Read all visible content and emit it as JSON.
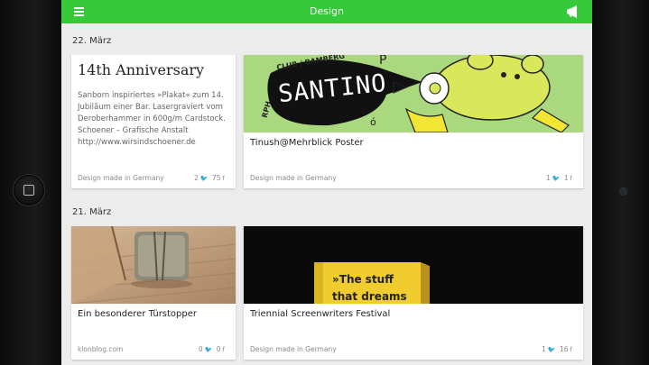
{
  "header": {
    "title": "Design"
  },
  "sections": [
    {
      "date": "22. März"
    },
    {
      "date": "21. März"
    }
  ],
  "cards": [
    {
      "title": "14th Anniversary",
      "text": "Sanborn inspiriertes »Plakat« zum 14. Jubiläum einer Bar. Lasergraviert vom Deroberhammer in 600g/m Cardstock. Schoener – Grafische Anstalt http://www.wirsindschoener.de",
      "source": "Design made in Germany",
      "tweets": "2",
      "likes": "75"
    },
    {
      "title": "Tinush@Mehrblick Poster",
      "image_text": "SANTINO",
      "image_text_2": "CLUB / BAMBERG",
      "image_text_3": "RPH",
      "source": "Design made in Germany",
      "tweets": "1",
      "likes": "1"
    },
    {
      "title": "Ein besonderer Türstopper",
      "source": "klonblog.com",
      "tweets": "0",
      "likes": "0"
    },
    {
      "title": "Triennial Screenwriters Festival",
      "image_text": "»The stuff",
      "image_text_2": "that dreams",
      "source": "Design made in Germany",
      "tweets": "1",
      "likes": "16"
    }
  ],
  "colors": {
    "accent": "#36c93a",
    "background": "#ececec"
  },
  "icons": {
    "twitter": "twitter-icon",
    "facebook": "facebook-icon",
    "menu": "hamburger-menu-icon",
    "announce": "megaphone-icon"
  }
}
